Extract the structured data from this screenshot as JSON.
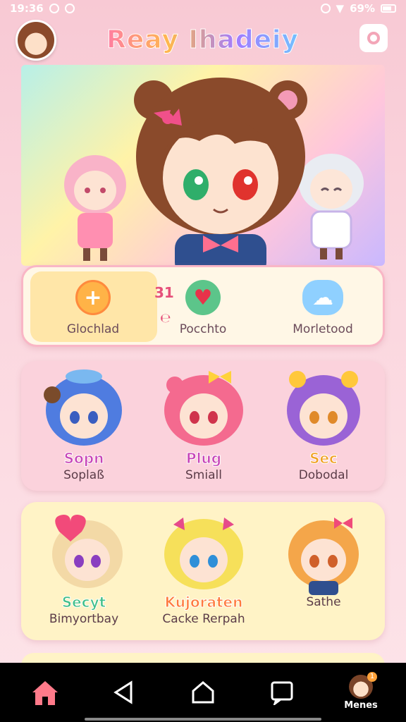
{
  "status_bar": {
    "time": "19:36",
    "battery": "69%"
  },
  "header": {
    "title": "Reay Ihadeiy"
  },
  "quick_actions": [
    {
      "label": "Glochlad",
      "icon": "plus-icon",
      "color": "#ffb347"
    },
    {
      "label": "Pocchto",
      "icon": "heart-icon",
      "color": "#5cc58a"
    },
    {
      "label": "Morletood",
      "icon": "cloud-icon",
      "color": "#8fd0ff"
    }
  ],
  "quick_note": {
    "top": "31",
    "bottom": "℮"
  },
  "characters_row1": [
    {
      "tag": "Sopn",
      "name": "Soplaß",
      "tag_color": "#c745b8",
      "hair": "#4f7ce0"
    },
    {
      "tag": "Plug",
      "name": "Smiall",
      "tag_color": "#c745b8",
      "hair": "#f46a8f"
    },
    {
      "tag": "Sec",
      "name": "Dobodal",
      "tag_color": "#f0a020",
      "hair": "#9a63d6"
    }
  ],
  "characters_row2": [
    {
      "tag": "Secyt",
      "name": "Bimyortbay",
      "tag_color": "#3fbf8a",
      "hair": "#f3d9a6"
    },
    {
      "tag": "Kujoraten",
      "name": "Cacke Rerpah",
      "tag_color": "#ff7a3d",
      "hair": "#f6e05a"
    },
    {
      "tag": "",
      "name": "Sathe",
      "tag_color": "#ff7a3d",
      "hair": "#f4a64a"
    }
  ],
  "bottom_nav": {
    "profile_label": "Menes",
    "badge": "1"
  }
}
